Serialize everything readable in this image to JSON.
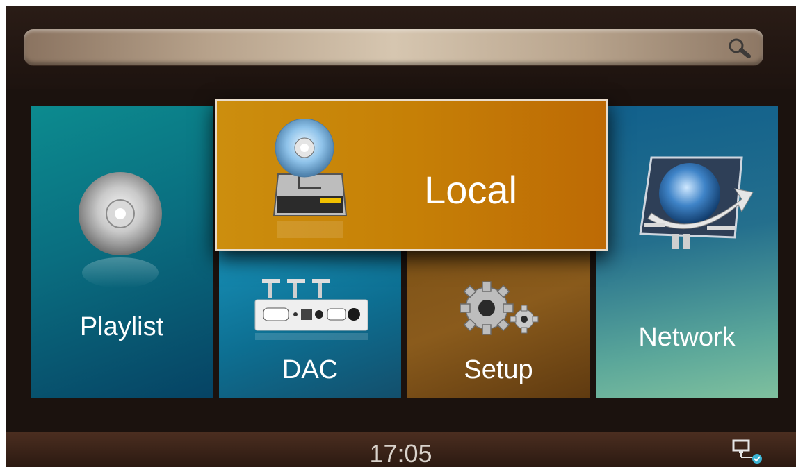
{
  "search": {
    "placeholder": "",
    "value": "",
    "icon": "search-icon"
  },
  "tiles": {
    "local": {
      "label": "Local",
      "icon": "hard-drive-disc-icon",
      "selected": true,
      "color": "#c68006"
    },
    "playlist": {
      "label": "Playlist",
      "icon": "cd-disc-icon",
      "color": "#0a6e80"
    },
    "dac": {
      "label": "DAC",
      "icon": "dac-device-icon",
      "color": "#0d6f92"
    },
    "setup": {
      "label": "Setup",
      "icon": "gears-icon",
      "color": "#8a5b1c"
    },
    "network": {
      "label": "Network",
      "icon": "network-globe-icon",
      "color": "#246f8d"
    }
  },
  "status": {
    "time": "17:05",
    "network_icon": "network-connected-icon"
  }
}
